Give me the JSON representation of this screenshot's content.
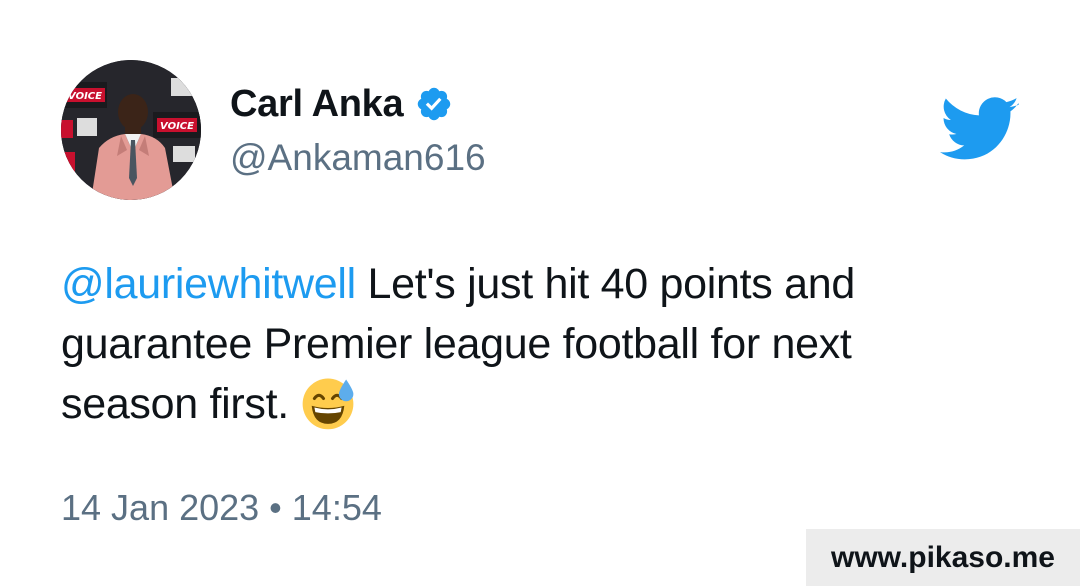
{
  "author": {
    "display_name": "Carl Anka",
    "handle": "@Ankaman616",
    "verified": true
  },
  "tweet": {
    "mention": "@lauriewhitwell",
    "text": " Let's just hit 40 points and guarantee Premier league football for next season first.",
    "emoji": "grinning-face-with-sweat",
    "timestamp": "14 Jan 2023 • 14:54"
  },
  "watermark": "www.pikaso.me",
  "colors": {
    "link": "#1d9bf0",
    "secondary_text": "#5b7083",
    "primary_text": "#0f1419",
    "verified_badge": "#1d9bf0",
    "twitter_bird": "#1d9bf0"
  },
  "icons": {
    "brand": "twitter-bird-icon",
    "verified": "verified-badge-icon"
  }
}
